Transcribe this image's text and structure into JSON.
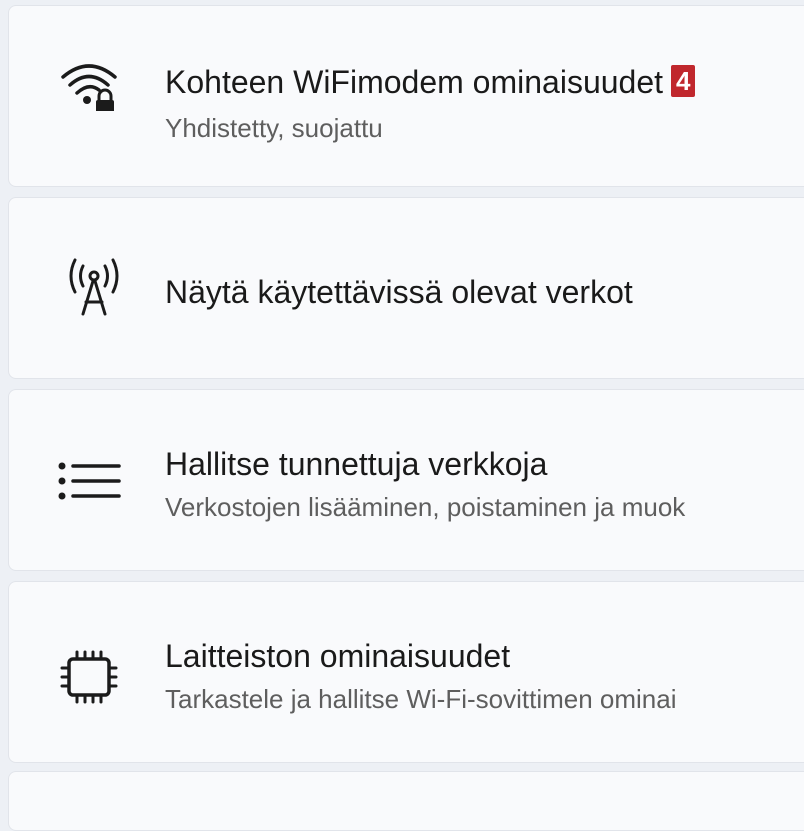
{
  "items": [
    {
      "title": "Kohteen WiFimodem ominaisuudet",
      "subtitle": "Yhdistetty, suojattu",
      "icon": "wifi-lock-icon"
    },
    {
      "title": "Näytä käytettävissä olevat verkot",
      "subtitle": "",
      "icon": "antenna-tower-icon"
    },
    {
      "title": "Hallitse tunnettuja verkkoja",
      "subtitle": "Verkostojen lisääminen, poistaminen ja muok",
      "icon": "bullet-list-icon"
    },
    {
      "title": "Laitteiston ominaisuudet",
      "subtitle": "Tarkastele ja hallitse Wi-Fi-sovittimen ominai",
      "icon": "chip-icon"
    }
  ],
  "badge": "4",
  "colors": {
    "background": "#edf0f5",
    "card": "#f9fafc",
    "badge": "#c0272d",
    "subtitle": "#5e5e5e"
  }
}
